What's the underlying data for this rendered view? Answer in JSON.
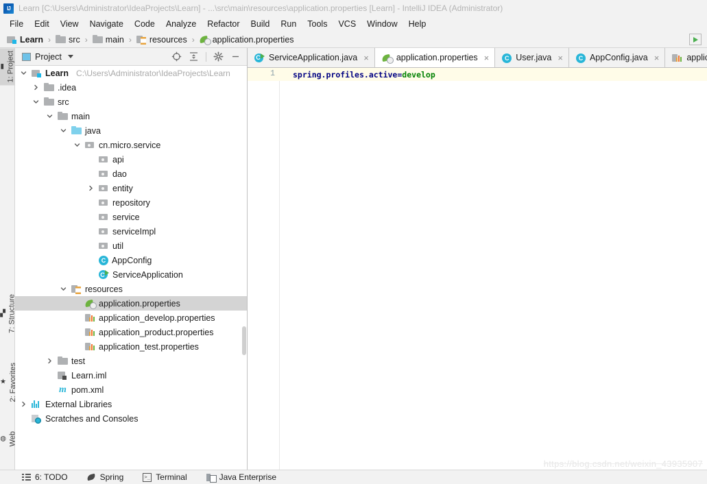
{
  "window": {
    "title": "Learn [C:\\Users\\Administrator\\IdeaProjects\\Learn] - ...\\src\\main\\resources\\application.properties [Learn] - IntelliJ IDEA (Administrator)",
    "logo_icon": "intellij-idea-logo"
  },
  "menu": {
    "items": [
      {
        "label": "File"
      },
      {
        "label": "Edit"
      },
      {
        "label": "View"
      },
      {
        "label": "Navigate"
      },
      {
        "label": "Code"
      },
      {
        "label": "Analyze"
      },
      {
        "label": "Refactor"
      },
      {
        "label": "Build"
      },
      {
        "label": "Run"
      },
      {
        "label": "Tools"
      },
      {
        "label": "VCS"
      },
      {
        "label": "Window"
      },
      {
        "label": "Help"
      }
    ]
  },
  "navbar": {
    "crumbs": [
      {
        "label": "Learn",
        "icon": "module-icon",
        "bold": true
      },
      {
        "label": "src",
        "icon": "folder-icon",
        "bold": false
      },
      {
        "label": "main",
        "icon": "folder-icon",
        "bold": false
      },
      {
        "label": "resources",
        "icon": "resources-folder-icon",
        "bold": false
      },
      {
        "label": "application.properties",
        "icon": "spring-properties-icon",
        "bold": false
      }
    ],
    "separator": "›",
    "run_button_icon": "run-green-arrow-icon"
  },
  "left_tool_strip": {
    "tabs": [
      {
        "label": "1: Project",
        "shortcut": "1",
        "icon": "project-folder-icon",
        "active": true
      },
      {
        "label": "7: Structure",
        "shortcut": "7",
        "icon": "structure-icon",
        "active": false
      },
      {
        "label": "2: Favorites",
        "shortcut": "2",
        "icon": "star-icon",
        "active": false
      },
      {
        "label": "Web",
        "shortcut": "",
        "icon": "globe-icon",
        "active": false
      }
    ]
  },
  "project_panel": {
    "title": "Project",
    "title_icon": "project-view-icon",
    "dropdown_icon": "chevron-down-icon",
    "toolbar": [
      {
        "name": "locate-icon"
      },
      {
        "name": "collapse-all-icon"
      },
      {
        "name": "gear-icon"
      },
      {
        "name": "minimize-icon"
      }
    ],
    "tree": [
      {
        "label": "Learn",
        "sub": "C:\\Users\\Administrator\\IdeaProjects\\Learn",
        "icon": "module",
        "indent": 0,
        "arrow": "down",
        "bold": true,
        "selected": false
      },
      {
        "label": ".idea",
        "sub": "",
        "icon": "folder-gray",
        "indent": 1,
        "arrow": "right",
        "bold": false,
        "selected": false
      },
      {
        "label": "src",
        "sub": "",
        "icon": "folder-gray",
        "indent": 1,
        "arrow": "down",
        "bold": false,
        "selected": false
      },
      {
        "label": "main",
        "sub": "",
        "icon": "folder-gray",
        "indent": 2,
        "arrow": "down",
        "bold": false,
        "selected": false
      },
      {
        "label": "java",
        "sub": "",
        "icon": "folder-blue",
        "indent": 3,
        "arrow": "down",
        "bold": false,
        "selected": false
      },
      {
        "label": "cn.micro.service",
        "sub": "",
        "icon": "pkg",
        "indent": 4,
        "arrow": "down",
        "bold": false,
        "selected": false
      },
      {
        "label": "api",
        "sub": "",
        "icon": "pkg",
        "indent": 5,
        "arrow": "none",
        "bold": false,
        "selected": false
      },
      {
        "label": "dao",
        "sub": "",
        "icon": "pkg",
        "indent": 5,
        "arrow": "none",
        "bold": false,
        "selected": false
      },
      {
        "label": "entity",
        "sub": "",
        "icon": "pkg",
        "indent": 5,
        "arrow": "right",
        "bold": false,
        "selected": false
      },
      {
        "label": "repository",
        "sub": "",
        "icon": "pkg",
        "indent": 5,
        "arrow": "none",
        "bold": false,
        "selected": false
      },
      {
        "label": "service",
        "sub": "",
        "icon": "pkg",
        "indent": 5,
        "arrow": "none",
        "bold": false,
        "selected": false
      },
      {
        "label": "serviceImpl",
        "sub": "",
        "icon": "pkg",
        "indent": 5,
        "arrow": "none",
        "bold": false,
        "selected": false
      },
      {
        "label": "util",
        "sub": "",
        "icon": "pkg",
        "indent": 5,
        "arrow": "none",
        "bold": false,
        "selected": false
      },
      {
        "label": "AppConfig",
        "sub": "",
        "icon": "classico",
        "indent": 5,
        "arrow": "none",
        "bold": false,
        "selected": false
      },
      {
        "label": "ServiceApplication",
        "sub": "",
        "icon": "classrun",
        "indent": 5,
        "arrow": "none",
        "bold": false,
        "selected": false
      },
      {
        "label": "resources",
        "sub": "",
        "icon": "resources",
        "indent": 3,
        "arrow": "down",
        "bold": false,
        "selected": false
      },
      {
        "label": "application.properties",
        "sub": "",
        "icon": "spring-leaf",
        "indent": 4,
        "arrow": "none",
        "bold": false,
        "selected": true
      },
      {
        "label": "application_develop.properties",
        "sub": "",
        "icon": "props",
        "indent": 4,
        "arrow": "none",
        "bold": false,
        "selected": false
      },
      {
        "label": "application_product.properties",
        "sub": "",
        "icon": "props",
        "indent": 4,
        "arrow": "none",
        "bold": false,
        "selected": false
      },
      {
        "label": "application_test.properties",
        "sub": "",
        "icon": "props",
        "indent": 4,
        "arrow": "none",
        "bold": false,
        "selected": false
      },
      {
        "label": "test",
        "sub": "",
        "icon": "folder-gray",
        "indent": 2,
        "arrow": "right",
        "bold": false,
        "selected": false
      },
      {
        "label": "Learn.iml",
        "sub": "",
        "icon": "iml",
        "indent": 2,
        "arrow": "none",
        "bold": false,
        "selected": false
      },
      {
        "label": "pom.xml",
        "sub": "",
        "icon": "maven",
        "indent": 2,
        "arrow": "none",
        "bold": false,
        "selected": false
      },
      {
        "label": "External Libraries",
        "sub": "",
        "icon": "libs",
        "indent": 0,
        "arrow": "right",
        "bold": false,
        "selected": false
      },
      {
        "label": "Scratches and Consoles",
        "sub": "",
        "icon": "scratch",
        "indent": 0,
        "arrow": "none",
        "bold": false,
        "selected": false
      }
    ]
  },
  "editor": {
    "tabs": [
      {
        "label": "ServiceApplication.java",
        "icon": "java-class-run-icon",
        "active": false,
        "close": "×"
      },
      {
        "label": "application.properties",
        "icon": "spring-properties-icon",
        "active": true,
        "close": "×"
      },
      {
        "label": "User.java",
        "icon": "java-class-icon",
        "active": false,
        "close": "×"
      },
      {
        "label": "AppConfig.java",
        "icon": "java-class-icon",
        "active": false,
        "close": "×"
      },
      {
        "label": "applicati",
        "icon": "properties-icon",
        "active": false,
        "close": ""
      }
    ],
    "line_number": "1",
    "code": {
      "key_part1": "spring",
      "dot1": ".",
      "key_part2": "profiles",
      "dot2": ".",
      "key_part3": "active",
      "equals": "=",
      "value": "develop"
    }
  },
  "statusbar": {
    "items": [
      {
        "label": "6: TODO",
        "icon": "todo-icon"
      },
      {
        "label": "Spring",
        "icon": "spring-icon"
      },
      {
        "label": "Terminal",
        "icon": "terminal-icon"
      },
      {
        "label": "Java Enterprise",
        "icon": "java-enterprise-icon"
      }
    ]
  },
  "watermark": {
    "text": "https://blog.csdn.net/weixin_43935907"
  },
  "colors": {
    "chrome_bg": "#f2f2f2",
    "panel_bg": "#ffffff",
    "selection": "#d4d4d4",
    "caret_line": "#fffce8",
    "code_key": "#000082",
    "code_value": "#008000",
    "title_text": "#b4b4b4",
    "path_text": "#a9a9a9"
  }
}
